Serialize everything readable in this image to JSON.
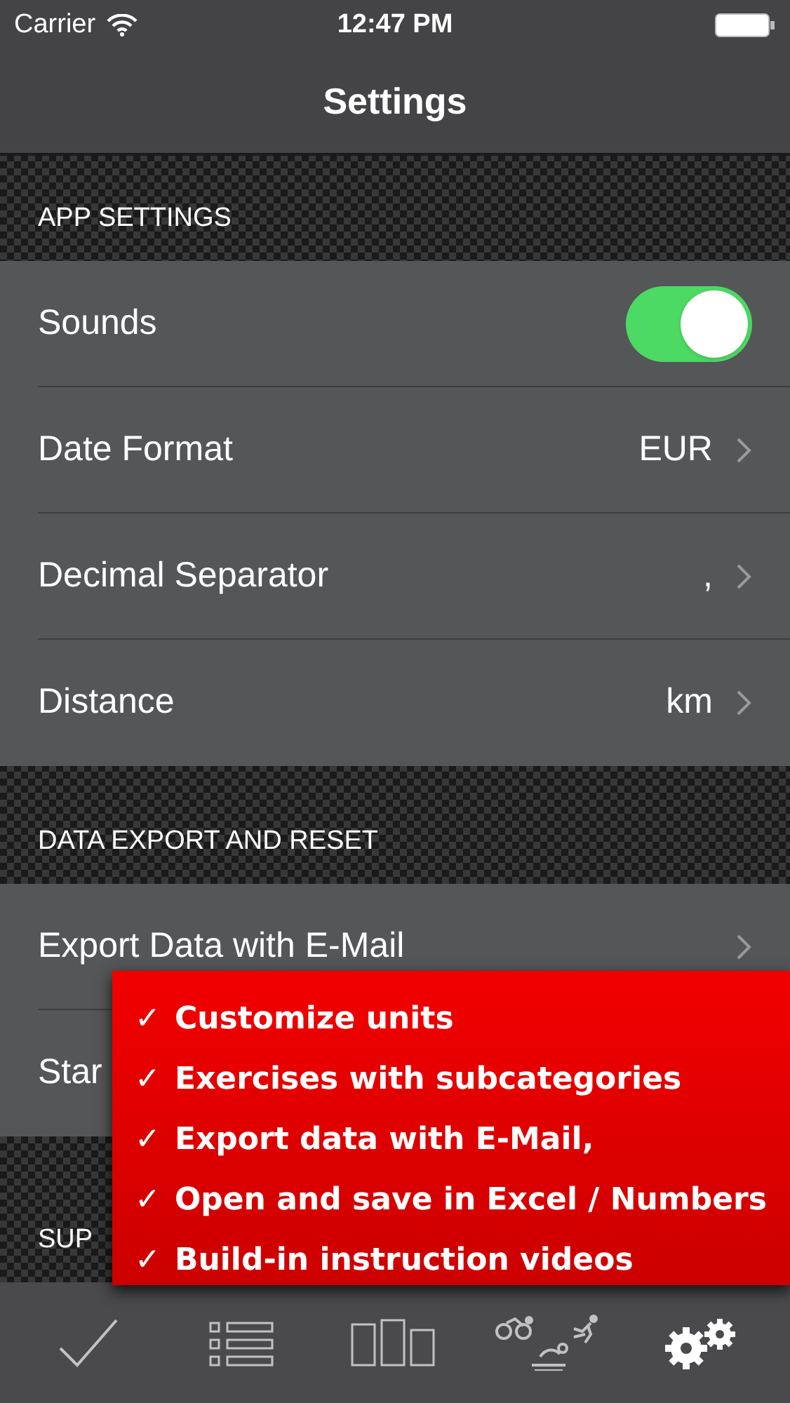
{
  "status_bar": {
    "carrier": "Carrier",
    "time": "12:47 PM"
  },
  "nav": {
    "title": "Settings"
  },
  "sections": [
    {
      "header": "APP SETTINGS",
      "rows": [
        {
          "kind": "toggle",
          "label": "Sounds",
          "on": true
        },
        {
          "kind": "value",
          "label": "Date Format",
          "value": "EUR",
          "chevron": true
        },
        {
          "kind": "value",
          "label": "Decimal Separator",
          "value": ",",
          "chevron": true
        },
        {
          "kind": "value",
          "label": "Distance",
          "value": "km",
          "chevron": true
        }
      ]
    },
    {
      "header": "DATA EXPORT AND RESET",
      "rows": [
        {
          "kind": "value",
          "label": "Export Data with E-Mail",
          "chevron": true
        },
        {
          "kind": "value",
          "label": "Star",
          "chevron": false
        }
      ]
    },
    {
      "header": "SUP"
    }
  ],
  "promo": {
    "items": [
      "Customize units",
      "Exercises with subcategories",
      "Export data with E-Mail,",
      "Open and save in Excel / Numbers",
      "Build-in instruction videos"
    ],
    "mark": "✓"
  },
  "tabs": [
    {
      "kind": "check",
      "selected": false
    },
    {
      "kind": "list",
      "selected": false
    },
    {
      "kind": "bars",
      "selected": false
    },
    {
      "kind": "sports",
      "selected": false
    },
    {
      "kind": "gears",
      "selected": true
    }
  ]
}
